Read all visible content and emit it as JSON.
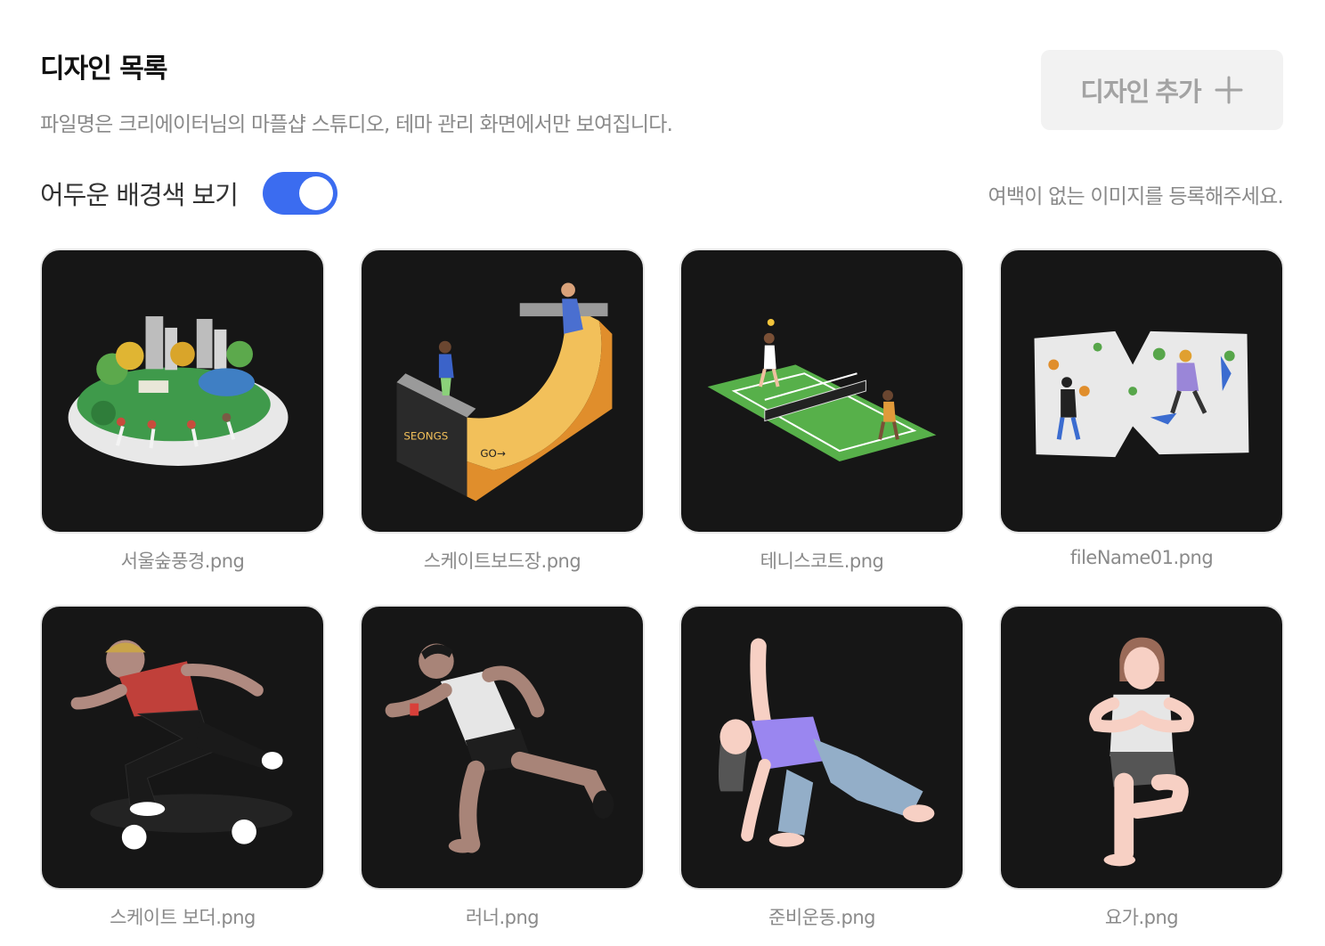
{
  "header": {
    "title": "디자인 목록",
    "subtitle": "파일명은 크리에이터님의 마플샵 스튜디오, 테마 관리 화면에서만 보여집니다."
  },
  "add_button": {
    "label": "디자인 추가",
    "icon": "plus-icon"
  },
  "dark_background": {
    "label": "어두운 배경색 보기",
    "enabled": true,
    "accent_color": "#3b6cf0"
  },
  "hint": "여백이 없는 이미지를 등록해주세요.",
  "designs": [
    {
      "filename": "서울숲풍경.png",
      "illustration": "park-landscape"
    },
    {
      "filename": "스케이트보드장.png",
      "illustration": "skate-ramp"
    },
    {
      "filename": "테니스코트.png",
      "illustration": "tennis-court"
    },
    {
      "filename": "fileName01.png",
      "illustration": "climbing-wall"
    },
    {
      "filename": "스케이트 보더.png",
      "illustration": "skateboarder"
    },
    {
      "filename": "러너.png",
      "illustration": "runner"
    },
    {
      "filename": "준비운동.png",
      "illustration": "stretching"
    },
    {
      "filename": "요가.png",
      "illustration": "yoga"
    }
  ]
}
